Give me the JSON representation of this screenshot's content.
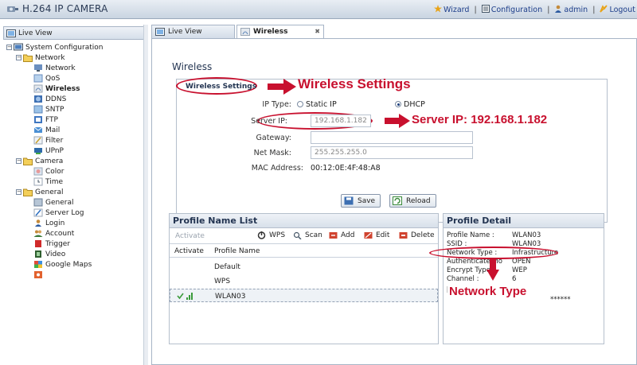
{
  "app": {
    "title": "H.264 IP CAMERA"
  },
  "header_nav": [
    {
      "label": "Wizard",
      "icon": "wizard-icon"
    },
    {
      "label": "Configuration",
      "icon": "configuration-icon"
    },
    {
      "label": "admin",
      "icon": "user-icon"
    },
    {
      "label": "Logout",
      "icon": "logout-icon"
    }
  ],
  "left_panel": {
    "tab_label": "Live View"
  },
  "tree": {
    "root": "System Configuration",
    "network": "Network",
    "network_items": [
      "Network",
      "QoS",
      "Wireless",
      "DDNS",
      "SNTP",
      "FTP",
      "Mail",
      "Filter",
      "UPnP"
    ],
    "camera": "Camera",
    "camera_items": [
      "Color",
      "Time"
    ],
    "general": "General",
    "general_items": [
      "General",
      "Server Log",
      "Login",
      "Account",
      "Trigger",
      "Video",
      "Google Maps"
    ],
    "selected": "Wireless"
  },
  "tabs": [
    {
      "label": "Live View",
      "active": false
    },
    {
      "label": "Wireless",
      "active": true
    }
  ],
  "wireless": {
    "title": "Wireless",
    "settings_label": "Wireless Settings",
    "ip_type_label": "IP Type:",
    "static_ip_label": "Static IP",
    "dhcp_label": "DHCP",
    "selected_ip_type": "DHCP",
    "server_ip_label": "Server IP:",
    "server_ip_value": "192.168.1.182",
    "gateway_label": "Gateway:",
    "gateway_value": "",
    "netmask_label": "Net Mask:",
    "netmask_value": "255.255.255.0",
    "mac_label": "MAC Address:",
    "mac_value": "00:12:0E:4F:48:A8",
    "save_label": "Save",
    "reload_label": "Reload"
  },
  "annotations": {
    "wireless_settings": "Wireless Settings",
    "server_ip": "Server IP: 192.168.1.182",
    "network_type": "Network Type",
    "color": "#c8102e"
  },
  "profile_list": {
    "title": "Profile Name List",
    "toolbar": {
      "activate": "Activate",
      "wps": "WPS",
      "scan": "Scan",
      "add": "Add",
      "edit": "Edit",
      "delete": "Delete"
    },
    "columns": [
      "Activate",
      "Profile Name"
    ],
    "rows": [
      {
        "name": "Default",
        "active": false
      },
      {
        "name": "WPS",
        "active": false
      },
      {
        "name": "WLAN03",
        "active": true
      }
    ]
  },
  "profile_detail": {
    "title": "Profile Detail",
    "rows": [
      {
        "key": "Profile Name :",
        "value": "WLAN03"
      },
      {
        "key": "SSID :",
        "value": "WLAN03"
      },
      {
        "key": "Network Type :",
        "value": "Infrastructure"
      },
      {
        "key": "Authenticate Mo",
        "value": "OPEN"
      },
      {
        "key": "Encrypt Type :",
        "value": "WEP"
      },
      {
        "key": "Channel :",
        "value": "6"
      },
      {
        "key": "[",
        "value": ""
      },
      {
        "key": "",
        "value": "******"
      }
    ]
  }
}
